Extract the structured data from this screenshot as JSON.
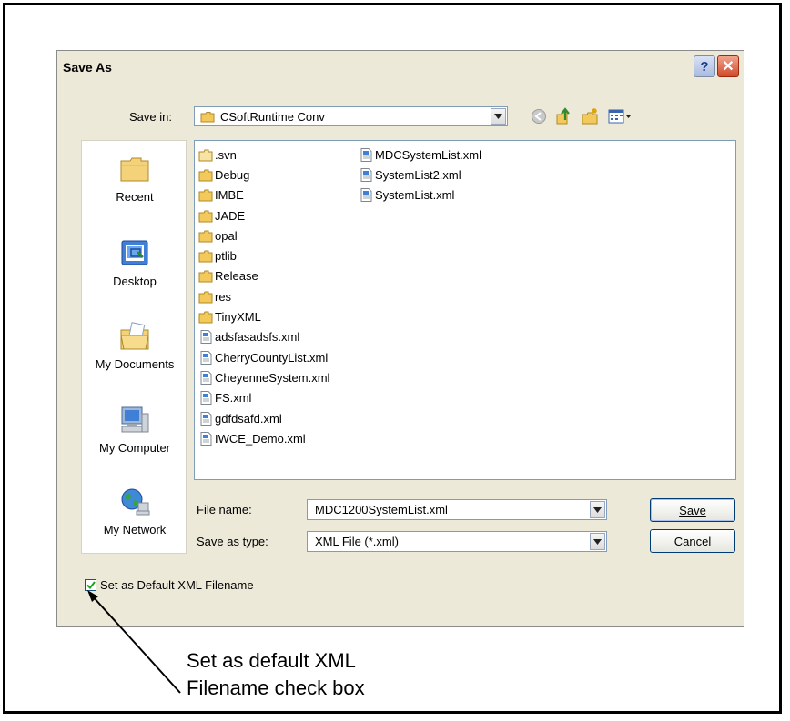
{
  "dialog": {
    "title": "Save As",
    "help_glyph": "?",
    "close_glyph": "✕"
  },
  "save_in": {
    "label": "Save in:",
    "value": "CSoftRuntime Conv"
  },
  "toolbar_icons": [
    "back-icon",
    "up-folder-icon",
    "new-folder-icon",
    "views-menu-icon"
  ],
  "places": [
    {
      "label": "Recent",
      "icon": "recent-folder-icon"
    },
    {
      "label": "Desktop",
      "icon": "desktop-icon"
    },
    {
      "label": "My Documents",
      "icon": "my-documents-icon"
    },
    {
      "label": "My Computer",
      "icon": "my-computer-icon"
    },
    {
      "label": "My Network",
      "icon": "my-network-icon"
    }
  ],
  "files": {
    "column1": [
      {
        "name": ".svn",
        "type": "folder-light"
      },
      {
        "name": "Debug",
        "type": "folder"
      },
      {
        "name": "IMBE",
        "type": "folder"
      },
      {
        "name": "JADE",
        "type": "folder"
      },
      {
        "name": "opal",
        "type": "folder"
      },
      {
        "name": "ptlib",
        "type": "folder"
      },
      {
        "name": "Release",
        "type": "folder"
      },
      {
        "name": "res",
        "type": "folder"
      },
      {
        "name": "TinyXML",
        "type": "folder"
      },
      {
        "name": "adsfasadsfs.xml",
        "type": "xml"
      },
      {
        "name": "CherryCountyList.xml",
        "type": "xml"
      },
      {
        "name": "CheyenneSystem.xml",
        "type": "xml"
      },
      {
        "name": "FS.xml",
        "type": "xml"
      },
      {
        "name": "gdfdsafd.xml",
        "type": "xml"
      },
      {
        "name": "IWCE_Demo.xml",
        "type": "xml"
      }
    ],
    "column2": [
      {
        "name": "MDCSystemList.xml",
        "type": "xml"
      },
      {
        "name": "SystemList2.xml",
        "type": "xml"
      },
      {
        "name": "SystemList.xml",
        "type": "xml"
      }
    ]
  },
  "file_name": {
    "label": "File name:",
    "value": "MDC1200SystemList.xml"
  },
  "save_as_type": {
    "label": "Save as type:",
    "value": "XML File (*.xml)"
  },
  "buttons": {
    "save": "Save",
    "cancel": "Cancel"
  },
  "default_checkbox": {
    "label": "Set as Default XML Filename",
    "checked": true
  },
  "annotation": {
    "line1": "Set as default XML",
    "line2": "Filename check box"
  },
  "colors": {
    "dialog_bg": "#ece9d8",
    "folder": "#f2c95a",
    "accent_border": "#7f9db9"
  }
}
